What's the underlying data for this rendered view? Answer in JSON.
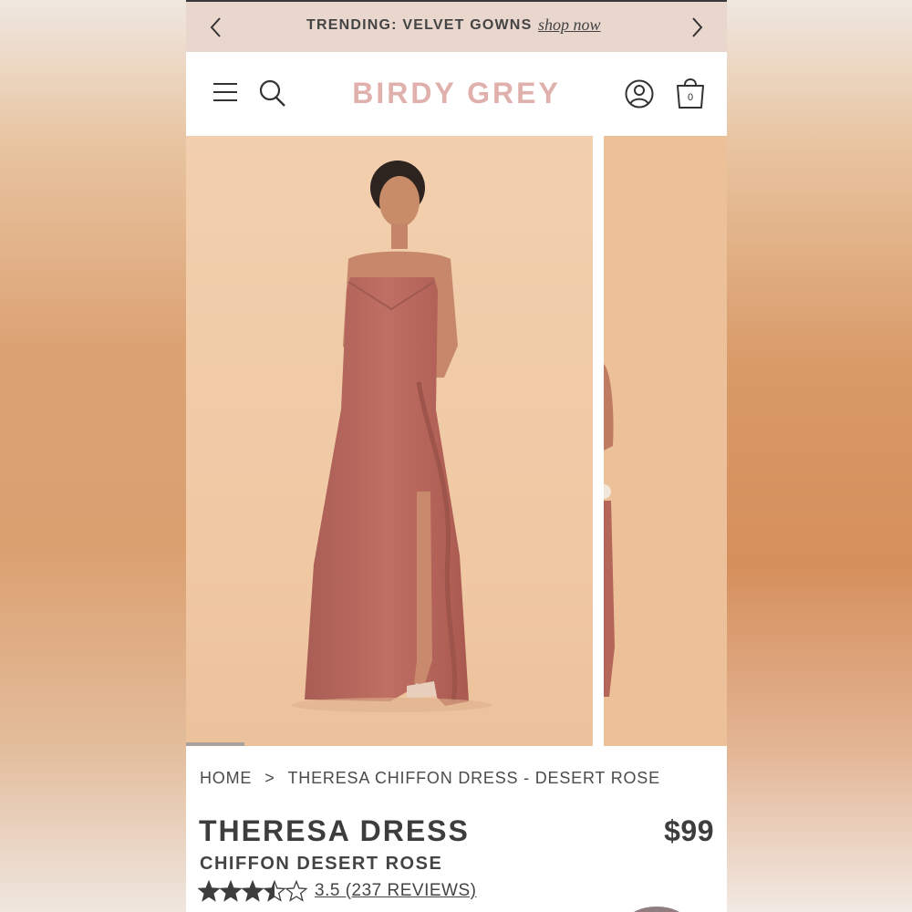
{
  "promo": {
    "text": "TRENDING: VELVET GOWNS",
    "link": "shop now"
  },
  "header": {
    "logo": "BIRDY GREY",
    "cart_count": "0"
  },
  "breadcrumb": {
    "home": "HOME",
    "separator": ">",
    "current": "THERESA CHIFFON DRESS - DESERT ROSE"
  },
  "product": {
    "name": "THERESA DRESS",
    "variant": "CHIFFON DESERT ROSE",
    "price": "$99",
    "rating_text": "3.5 (237 REVIEWS)",
    "rating_value": 3.5,
    "rating_max": 5
  },
  "gallery": {
    "current_index": 1,
    "dress_color": "#b96a5f",
    "backdrop_color": "#f0c9a6"
  },
  "colors": {
    "promo_bg": "#e9d7ce",
    "logo": "#dfb0ac",
    "text": "#3d3d3d"
  },
  "icons": [
    "chevron-left-icon",
    "chevron-right-icon",
    "menu-icon",
    "search-icon",
    "account-icon",
    "shopping-bag-icon",
    "star-icon"
  ]
}
